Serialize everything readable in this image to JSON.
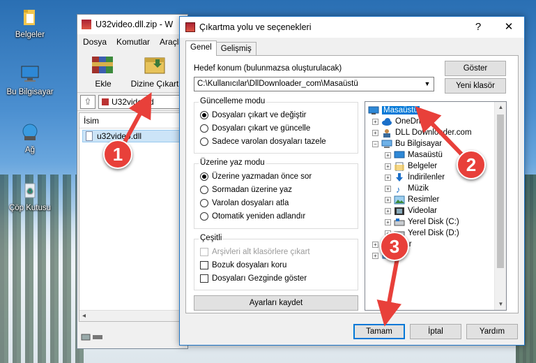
{
  "desktop": {
    "icons": [
      {
        "label": "Belgeler"
      },
      {
        "label": "Bu Bilgisayar"
      },
      {
        "label": "Ağ"
      },
      {
        "label": "Çöp Kutusu"
      }
    ]
  },
  "winrar": {
    "title": "U32video.dll.zip - W",
    "menu": [
      "Dosya",
      "Komutlar",
      "Araçla"
    ],
    "tools": [
      {
        "label": "Ekle",
        "icon": "add-archive-icon"
      },
      {
        "label": "Dizine Çıkart",
        "icon": "extract-to-icon"
      }
    ],
    "address": "U32video.d",
    "column_header": "İsim",
    "file": "u32video.dll"
  },
  "dialog": {
    "title": "Çıkartma yolu ve seçenekleri",
    "help_btn": "?",
    "close_btn": "✕",
    "tabs": [
      "Genel",
      "Gelişmiş"
    ],
    "dest_label": "Hedef konum (bulunmazsa oluşturulacak)",
    "dest_value": "C:\\Kullanıcılar\\DllDownloader_com\\Masaüstü",
    "show_btn": "Göster",
    "new_folder_btn": "Yeni klasör",
    "update_group": {
      "title": "Güncelleme modu",
      "options": [
        {
          "label": "Dosyaları çıkart ve değiştir",
          "checked": true
        },
        {
          "label": "Dosyaları çıkart ve güncelle",
          "checked": false
        },
        {
          "label": "Sadece varolan dosyaları tazele",
          "checked": false
        }
      ]
    },
    "overwrite_group": {
      "title": "Üzerine yaz modu",
      "options": [
        {
          "label": "Üzerine yazmadan önce sor",
          "checked": true
        },
        {
          "label": "Sormadan üzerine yaz",
          "checked": false
        },
        {
          "label": "Varolan dosyaları atla",
          "checked": false
        },
        {
          "label": "Otomatik yeniden adlandır",
          "checked": false
        }
      ]
    },
    "misc_group": {
      "title": "Çeşitli",
      "options": [
        {
          "label": "Arşivleri alt klasörlere çıkart",
          "checked": false,
          "disabled": true
        },
        {
          "label": "Bozuk dosyaları koru",
          "checked": false,
          "disabled": false
        },
        {
          "label": "Dosyaları Gezginde göster",
          "checked": false,
          "disabled": false
        }
      ]
    },
    "save_settings_btn": "Ayarları kaydet",
    "tree": [
      {
        "label": "Masaüstü",
        "selected": true
      },
      {
        "label": "OneDrive"
      },
      {
        "label": "DLL Downloader.com"
      },
      {
        "label": "Bu Bilgisayar"
      },
      {
        "label": "Masaüstü"
      },
      {
        "label": "Belgeler"
      },
      {
        "label": "İndirilenler"
      },
      {
        "label": "Müzik"
      },
      {
        "label": "Resimler"
      },
      {
        "label": "Videolar"
      },
      {
        "label": "Yerel Disk (C:)"
      },
      {
        "label": "Yerel Disk (D:)"
      },
      {
        "label": "liklar"
      }
    ],
    "ok_btn": "Tamam",
    "cancel_btn": "İptal",
    "help_button": "Yardım"
  },
  "markers": [
    "1",
    "2",
    "3"
  ],
  "colors": {
    "accent": "#0078d7",
    "arrow": "#e8403a"
  }
}
